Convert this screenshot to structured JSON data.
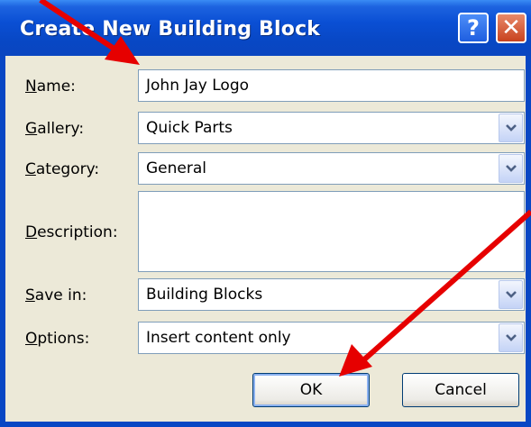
{
  "dialog": {
    "title": "Create New Building Block",
    "help_glyph": "?",
    "close_glyph": "✕"
  },
  "fields": {
    "name": {
      "label_accel": "N",
      "label_rest": "ame:",
      "value": "John Jay Logo"
    },
    "gallery": {
      "label_accel": "G",
      "label_rest": "allery:",
      "value": "Quick Parts"
    },
    "category": {
      "label_accel": "C",
      "label_rest": "ategory:",
      "value": "General"
    },
    "description": {
      "label_accel": "D",
      "label_rest": "escription:",
      "value": ""
    },
    "save_in": {
      "label_accel": "S",
      "label_rest": "ave in:",
      "value": "Building Blocks"
    },
    "options": {
      "label_accel": "O",
      "label_rest": "ptions:",
      "value": "Insert content only"
    }
  },
  "buttons": {
    "ok": "OK",
    "cancel": "Cancel"
  },
  "colors": {
    "titlebar": "#0a4fd4",
    "dialog_bg": "#ece9d8",
    "annotation_arrow": "#e60000"
  },
  "icons": {
    "dropdown": "chevron-down-icon",
    "annotation": "red-arrow-icon"
  }
}
